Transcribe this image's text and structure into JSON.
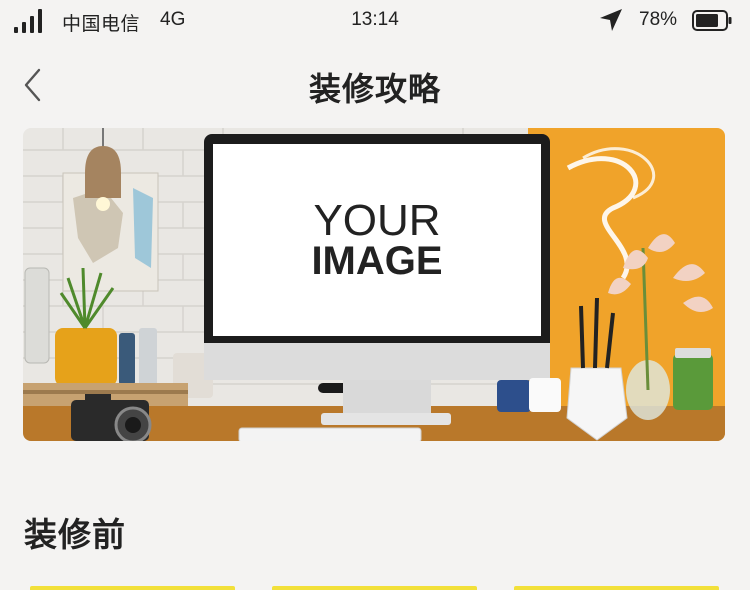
{
  "status_bar": {
    "carrier": "中国电信",
    "network": "4G",
    "time": "13:14",
    "battery_percent": "78%",
    "battery_level": 0.78,
    "signal_icon": "cellular-signal-icon",
    "location_icon": "location-arrow-icon",
    "battery_icon": "battery-icon"
  },
  "nav": {
    "title": "装修攻略",
    "back_icon": "chevron-left-icon"
  },
  "banner": {
    "screen_text_line1": "YOUR",
    "screen_text_line2": "IMAGE"
  },
  "section": {
    "title": "装修前"
  },
  "colors": {
    "background": "#f4f3f2",
    "accent_yellow": "#f2e03a",
    "wall_orange": "#f0a32a",
    "text": "#222222"
  }
}
